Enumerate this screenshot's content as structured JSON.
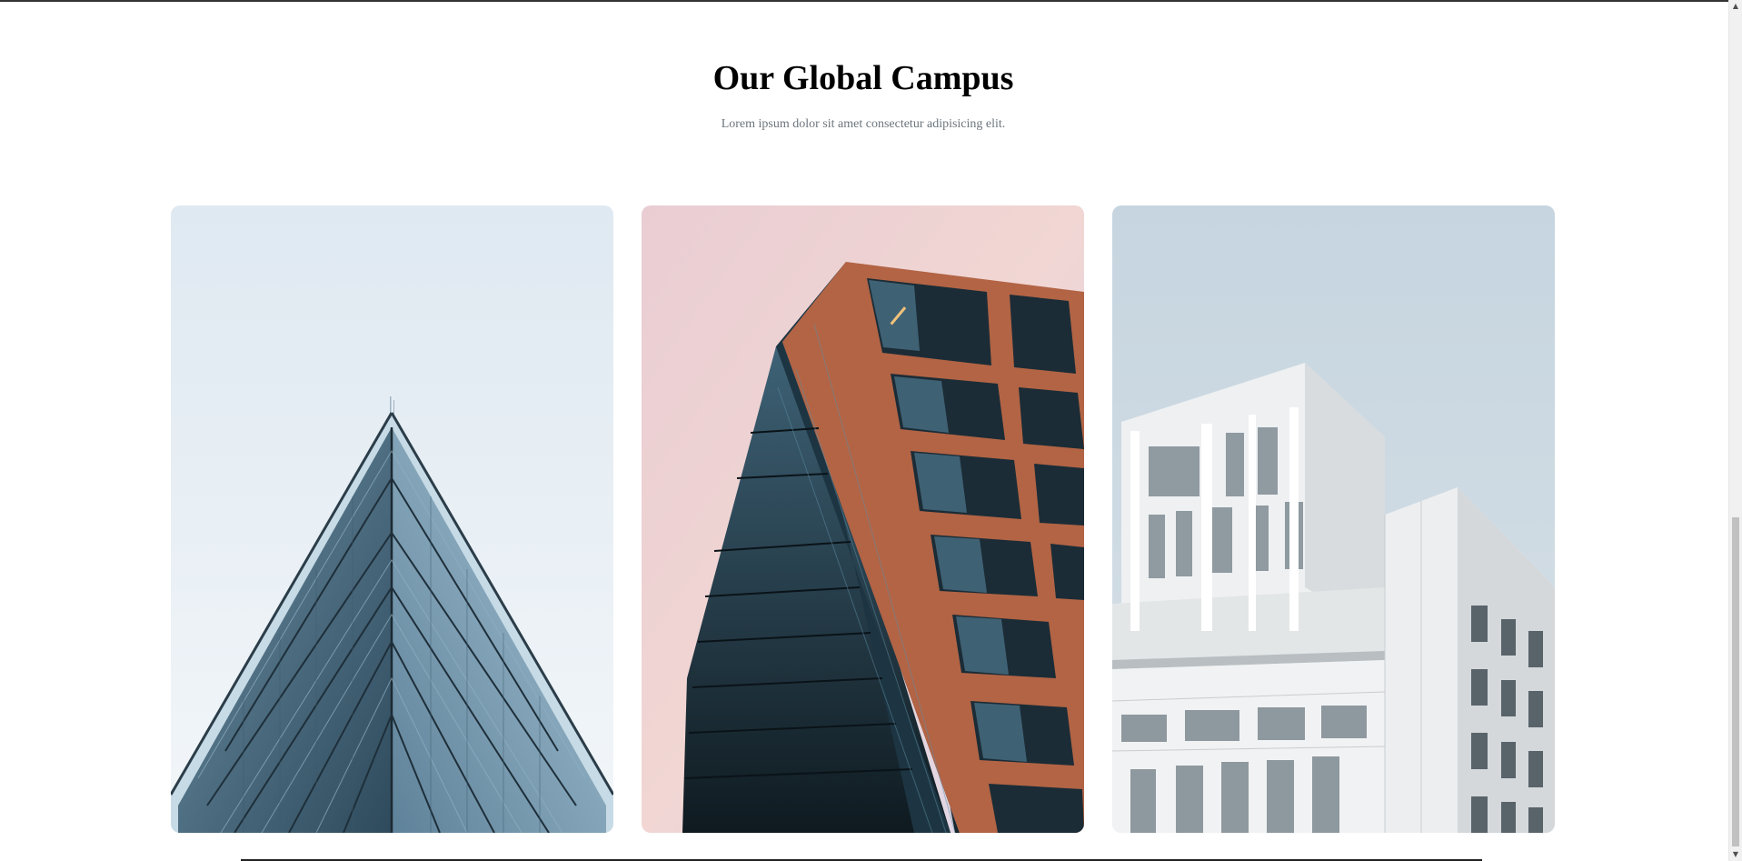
{
  "section": {
    "title": "Our Global Campus",
    "subtitle": "Lorem ipsum dolor sit amet consectetur adipisicing elit."
  },
  "gallery": {
    "cards": [
      {
        "name": "campus-photo-glass-pyramid",
        "alt": "Glass pyramid building against pale sky"
      },
      {
        "name": "campus-photo-copper-tower",
        "alt": "Glass and copper tower at sunset"
      },
      {
        "name": "campus-photo-white-modern",
        "alt": "White modern building with balconies"
      }
    ]
  },
  "scrollbar": {
    "up_icon": "▲",
    "down_icon": "▼"
  },
  "colors": {
    "title": "#000000",
    "subtitle": "#6c757d",
    "scroll_thumb": "#c1c1c1"
  }
}
